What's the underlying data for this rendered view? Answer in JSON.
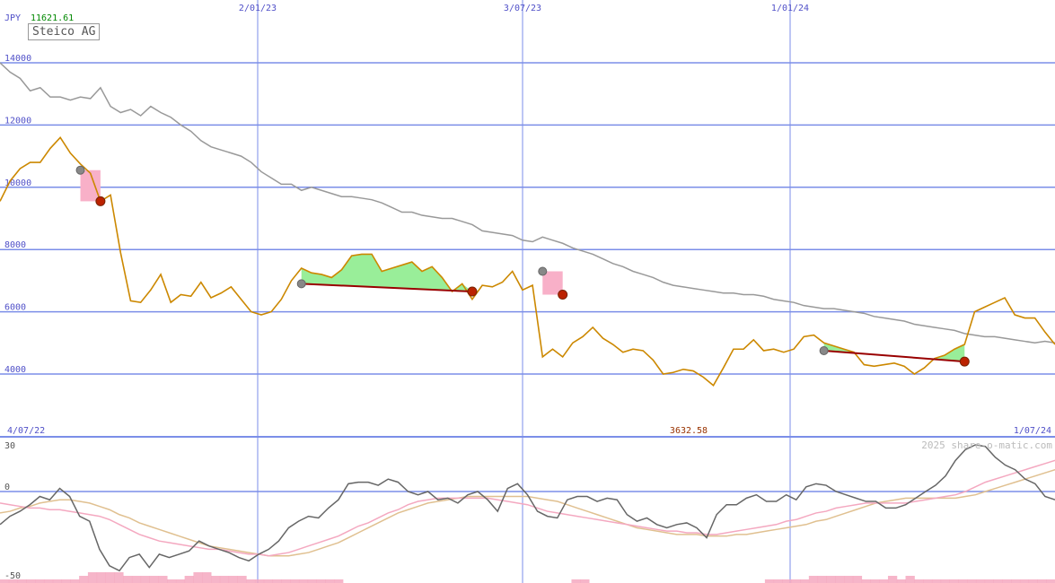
{
  "header": {
    "currency": "JPY",
    "last_value": "11621.61",
    "title": "Steico AG",
    "watermark": "2025 share-o-matic.com"
  },
  "colors": {
    "grid": "#7b8ee8",
    "axis_text": "#5050c8",
    "price_line": "#cc8800",
    "moving_avg": "#999999",
    "gain_fill": "#99ee99",
    "loss_fill": "#f8b0c8",
    "marker_red": "#bb2200",
    "marker_grey": "#888888",
    "value_green": "#008800",
    "osc_line": "#666666",
    "osc_pink": "#f4a8c0",
    "osc_tan": "#e0c090"
  },
  "chart_data": [
    {
      "type": "line",
      "title": "Steico AG",
      "ylabel": "JPY",
      "ylim": [
        3100,
        15000
      ],
      "y_ticks": [
        4000,
        6000,
        8000,
        10000,
        12000,
        14000
      ],
      "y_tick_labels": [
        "4000",
        "6000",
        "8000",
        "10000",
        "12000",
        "14000"
      ],
      "x_start_label": "4/07/22",
      "x_end_label": "1/07/24",
      "x_ticks": [
        "2/01/23",
        "3/07/23",
        "1/01/24"
      ],
      "x_tick_index": [
        29,
        59,
        89
      ],
      "min_label": "3632.58",
      "series": [
        {
          "role": "price",
          "values": [
            9550,
            10200,
            10600,
            10800,
            10800,
            11250,
            11600,
            11100,
            10750,
            10450,
            9550,
            9750,
            7900,
            6350,
            6300,
            6700,
            7200,
            6300,
            6550,
            6500,
            6950,
            6450,
            6600,
            6800,
            6400,
            6000,
            5900,
            6000,
            6400,
            7000,
            7400,
            7250,
            7200,
            7100,
            7350,
            7800,
            7850,
            7850,
            7300,
            7400,
            7500,
            7600,
            7300,
            7450,
            7100,
            6650,
            6900,
            6400,
            6850,
            6800,
            6950,
            7300,
            6700,
            6850,
            4550,
            4800,
            4550,
            5000,
            5200,
            5500,
            5150,
            4950,
            4700,
            4800,
            4750,
            4450,
            4000,
            4050,
            4150,
            4100,
            3900,
            3632,
            4200,
            4800,
            4800,
            5100,
            4750,
            4800,
            4700,
            4800,
            5200,
            5250,
            5000,
            4900,
            4800,
            4700,
            4300,
            4250,
            4300,
            4350,
            4250,
            4000,
            4200,
            4500,
            4600,
            4800,
            4950,
            6000,
            6150,
            6300,
            6450,
            5900,
            5800,
            5800,
            5350,
            4950
          ]
        },
        {
          "role": "moving_average",
          "values": [
            14000,
            13700,
            13500,
            13100,
            13200,
            12900,
            12900,
            12800,
            12900,
            12850,
            13200,
            12600,
            12400,
            12500,
            12300,
            12600,
            12400,
            12250,
            12000,
            11800,
            11500,
            11300,
            11200,
            11100,
            11000,
            10800,
            10500,
            10300,
            10100,
            10100,
            9900,
            10000,
            9900,
            9800,
            9700,
            9700,
            9650,
            9600,
            9500,
            9350,
            9200,
            9200,
            9100,
            9050,
            9000,
            9000,
            8900,
            8800,
            8600,
            8550,
            8500,
            8450,
            8300,
            8250,
            8400,
            8300,
            8200,
            8050,
            7950,
            7850,
            7700,
            7550,
            7450,
            7300,
            7200,
            7100,
            6950,
            6850,
            6800,
            6750,
            6700,
            6650,
            6600,
            6600,
            6550,
            6550,
            6500,
            6400,
            6350,
            6300,
            6200,
            6150,
            6100,
            6100,
            6050,
            6000,
            5950,
            5850,
            5800,
            5750,
            5700,
            5600,
            5550,
            5500,
            5450,
            5400,
            5300,
            5250,
            5200,
            5200,
            5150,
            5100,
            5050,
            5000,
            5050,
            5000
          ]
        }
      ],
      "annotations": [
        {
          "type": "loss",
          "from_index": 8,
          "to_index": 10,
          "from_value": 10550,
          "to_value": 9550
        },
        {
          "type": "gain",
          "from_index": 30,
          "to_index": 47,
          "from_value": 6900,
          "to_value": 6650
        },
        {
          "type": "loss",
          "from_index": 54,
          "to_index": 56,
          "from_value": 7300,
          "to_value": 6550
        },
        {
          "type": "gain",
          "from_index": 82,
          "to_index": 96,
          "from_value": 4750,
          "to_value": 4400
        },
        {
          "type": "gain",
          "from_index": 106,
          "to_index": 120,
          "from_value": 4900,
          "to_value": 5000
        }
      ]
    },
    {
      "type": "line",
      "ylim": [
        -50,
        30
      ],
      "y_ticks": [
        30,
        0,
        -50
      ],
      "y_tick_labels": [
        "30",
        "0",
        "-50"
      ],
      "series": [
        {
          "role": "oscillator",
          "values": [
            -20,
            -15,
            -12,
            -8,
            -3,
            -5,
            2,
            -3,
            -15,
            -18,
            -35,
            -45,
            -48,
            -40,
            -38,
            -46,
            -38,
            -40,
            -38,
            -36,
            -30,
            -33,
            -35,
            -37,
            -40,
            -42,
            -38,
            -35,
            -30,
            -22,
            -18,
            -15,
            -16,
            -10,
            -5,
            5,
            6,
            6,
            4,
            8,
            6,
            0,
            -2,
            0,
            -5,
            -4,
            -7,
            -2,
            0,
            -5,
            -12,
            2,
            5,
            -2,
            -12,
            -15,
            -16,
            -5,
            -3,
            -3,
            -6,
            -4,
            -5,
            -14,
            -18,
            -16,
            -20,
            -22,
            -20,
            -19,
            -22,
            -28,
            -14,
            -8,
            -8,
            -4,
            -2,
            -6,
            -6,
            -2,
            -5,
            3,
            5,
            4,
            0,
            -2,
            -4,
            -6,
            -6,
            -10,
            -10,
            -8,
            -4,
            0,
            4,
            10,
            20,
            27,
            30,
            29,
            22,
            17,
            14,
            8,
            5,
            -3,
            -5
          ]
        },
        {
          "role": "signal_fast",
          "values": [
            -7,
            -8,
            -9,
            -10,
            -10,
            -11,
            -11,
            -12,
            -13,
            -14,
            -15,
            -17,
            -20,
            -23,
            -26,
            -28,
            -30,
            -31,
            -32,
            -33,
            -34,
            -35,
            -35,
            -36,
            -37,
            -38,
            -38,
            -39,
            -38,
            -37,
            -35,
            -33,
            -31,
            -29,
            -27,
            -24,
            -21,
            -19,
            -16,
            -13,
            -11,
            -8,
            -6,
            -5,
            -4,
            -4,
            -4,
            -4,
            -4,
            -4,
            -5,
            -6,
            -7,
            -8,
            -10,
            -12,
            -13,
            -14,
            -15,
            -16,
            -17,
            -18,
            -19,
            -20,
            -21,
            -22,
            -23,
            -24,
            -24,
            -25,
            -25,
            -26,
            -26,
            -25,
            -24,
            -23,
            -22,
            -21,
            -20,
            -18,
            -17,
            -15,
            -13,
            -12,
            -10,
            -9,
            -8,
            -7,
            -7,
            -7,
            -7,
            -7,
            -6,
            -5,
            -4,
            -3,
            -2,
            0,
            3,
            6,
            8,
            10,
            12,
            14,
            16,
            18,
            20,
            22
          ]
        },
        {
          "role": "signal_slow",
          "values": [
            -13,
            -12,
            -10,
            -9,
            -7,
            -6,
            -5,
            -5,
            -6,
            -7,
            -9,
            -11,
            -14,
            -16,
            -19,
            -21,
            -23,
            -25,
            -27,
            -29,
            -31,
            -33,
            -34,
            -35,
            -36,
            -37,
            -38,
            -39,
            -39,
            -39,
            -38,
            -37,
            -35,
            -33,
            -31,
            -28,
            -25,
            -22,
            -19,
            -16,
            -13,
            -11,
            -9,
            -7,
            -6,
            -5,
            -4,
            -3,
            -3,
            -3,
            -3,
            -3,
            -3,
            -3,
            -4,
            -5,
            -6,
            -8,
            -10,
            -12,
            -14,
            -16,
            -18,
            -20,
            -22,
            -23,
            -24,
            -25,
            -26,
            -26,
            -26,
            -27,
            -27,
            -27,
            -26,
            -26,
            -25,
            -24,
            -23,
            -22,
            -21,
            -20,
            -18,
            -17,
            -15,
            -13,
            -11,
            -9,
            -7,
            -6,
            -5,
            -4,
            -4,
            -4,
            -4,
            -4,
            -4,
            -3,
            -2,
            0,
            2,
            4,
            6,
            8,
            10,
            12,
            14,
            16
          ]
        },
        {
          "role": "volume_bars",
          "values": [
            1,
            1,
            1,
            1,
            1,
            1,
            1,
            1,
            1,
            2,
            3,
            3,
            3,
            3,
            2,
            2,
            2,
            2,
            2,
            1,
            1,
            2,
            3,
            3,
            2,
            2,
            2,
            2,
            1,
            1,
            1,
            1,
            1,
            1,
            1,
            1,
            1,
            1,
            1,
            0,
            0,
            0,
            0,
            0,
            0,
            0,
            0,
            0,
            0,
            0,
            0,
            0,
            0,
            0,
            0,
            0,
            0,
            0,
            0,
            0,
            0,
            0,
            0,
            0,
            0,
            1,
            1,
            0,
            0,
            0,
            0,
            0,
            0,
            0,
            0,
            0,
            0,
            0,
            0,
            0,
            0,
            0,
            0,
            0,
            0,
            0,
            0,
            1,
            1,
            1,
            1,
            1,
            2,
            2,
            2,
            2,
            2,
            2,
            1,
            1,
            1,
            2,
            1,
            2,
            1,
            1,
            1,
            1,
            1,
            1,
            1,
            1,
            1,
            1,
            1,
            1,
            1,
            1,
            1,
            1
          ]
        }
      ]
    }
  ]
}
